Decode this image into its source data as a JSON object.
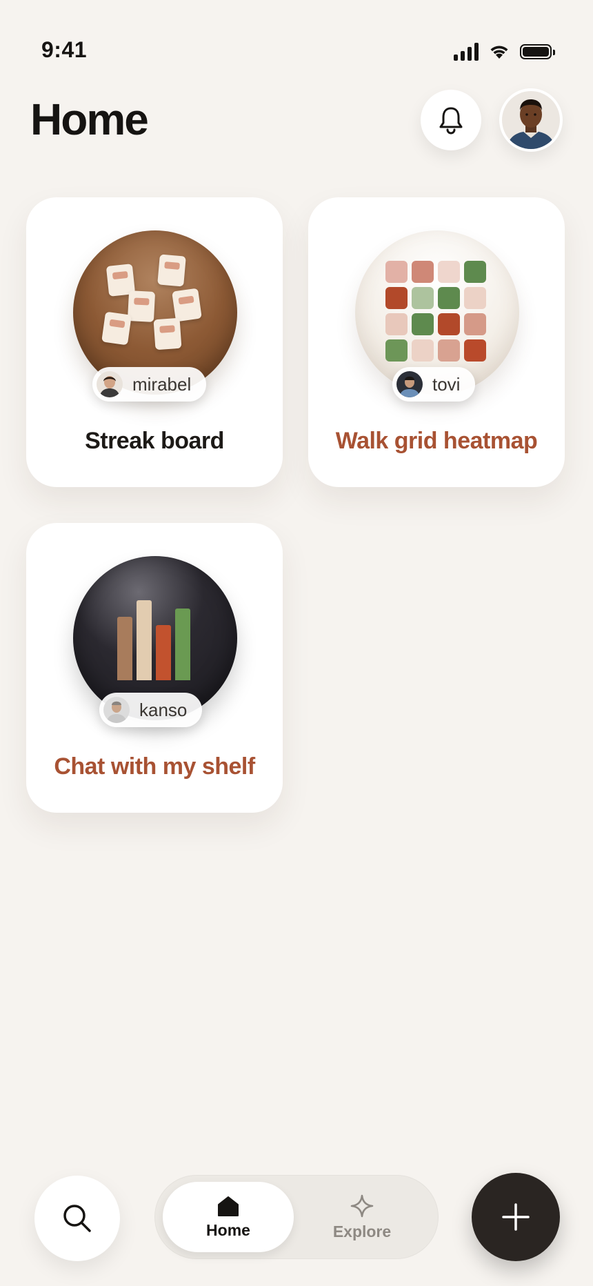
{
  "status_bar": {
    "time": "9:41",
    "icons": [
      "signal-icon",
      "wifi-icon",
      "battery-icon"
    ]
  },
  "header": {
    "title": "Home",
    "notification_icon": "bell-icon",
    "profile_avatar": "user-avatar"
  },
  "cards": [
    {
      "title": "Streak board",
      "author": "mirabel",
      "title_color": "#1d1a17",
      "thumbnail": "sticky-notes-orb"
    },
    {
      "title": "Walk grid heatmap",
      "author": "tovi",
      "title_color": "#a85233",
      "thumbnail": "heatmap-grid-orb"
    },
    {
      "title": "Chat with my shelf",
      "author": "kanso",
      "title_color": "#a85233",
      "thumbnail": "bar-chart-orb"
    }
  ],
  "bottom_nav": {
    "search_icon": "search-icon",
    "tabs": [
      {
        "label": "Home",
        "icon": "home-icon",
        "active": true
      },
      {
        "label": "Explore",
        "icon": "sparkle-icon",
        "active": false
      }
    ],
    "add_icon": "plus-icon"
  },
  "colors": {
    "background": "#f6f3ef",
    "accent": "#a85233",
    "fab": "#2a2522"
  }
}
